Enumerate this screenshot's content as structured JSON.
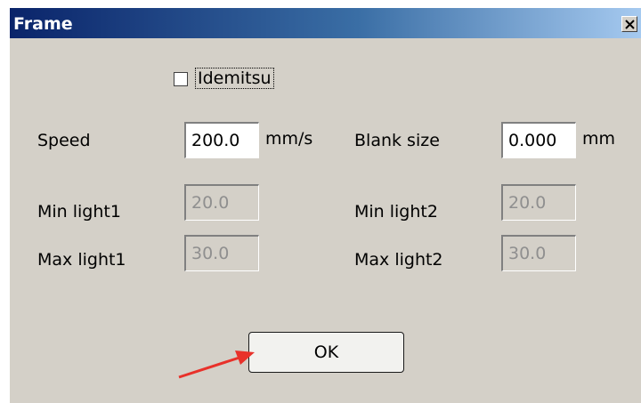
{
  "window": {
    "title": "Frame"
  },
  "titlebar": {
    "close_icon": "close-x-icon"
  },
  "form": {
    "checkbox": {
      "label": "Idemitsu",
      "checked": false
    },
    "speed": {
      "label": "Speed",
      "value": "200.0",
      "unit": "mm/s",
      "enabled": true
    },
    "blank_size": {
      "label": "Blank size",
      "value": "0.000",
      "unit": "mm",
      "enabled": true
    },
    "min_light1": {
      "label": "Min light1",
      "value": "20.0",
      "enabled": false
    },
    "min_light2": {
      "label": "Min light2",
      "value": "20.0",
      "enabled": false
    },
    "max_light1": {
      "label": "Max light1",
      "value": "30.0",
      "enabled": false
    },
    "max_light2": {
      "label": "Max light2",
      "value": "30.0",
      "enabled": false
    }
  },
  "buttons": {
    "ok": "OK"
  },
  "annotation": {
    "arrow_color": "#e8312a"
  },
  "colors": {
    "dialog_bg": "#d4d0c8",
    "titlebar_start": "#0a246a",
    "titlebar_end": "#a6caf0"
  }
}
